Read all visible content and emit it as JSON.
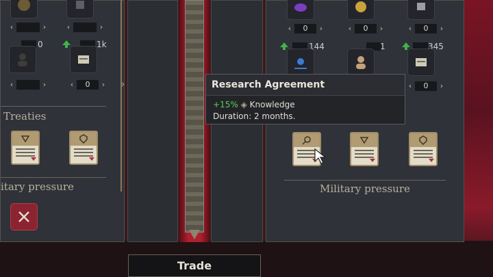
{
  "left_panel": {
    "top_stepper_values": [
      "",
      ""
    ],
    "resource_counts": [
      "0",
      "1k"
    ],
    "mid_stepper_values": [
      "",
      "0"
    ],
    "section_treaties": "Treaties",
    "section_military": "itary pressure"
  },
  "right_panel": {
    "top_stepper_values": [
      "0",
      "0",
      "0"
    ],
    "resource_counts": [
      "144",
      "1",
      "345"
    ],
    "mid_stepper_values": [
      "0"
    ],
    "section_military": "Military pressure"
  },
  "tooltip": {
    "title": "Research Agreement",
    "bonus_percent": "+15%",
    "bonus_resource": "Knowledge",
    "duration": "Duration: 2 months."
  },
  "trade_button": {
    "label": "Trade"
  },
  "colors": {
    "accent_green": "#56d15a",
    "card_red": "#b03040",
    "gold": "#a08d68"
  }
}
